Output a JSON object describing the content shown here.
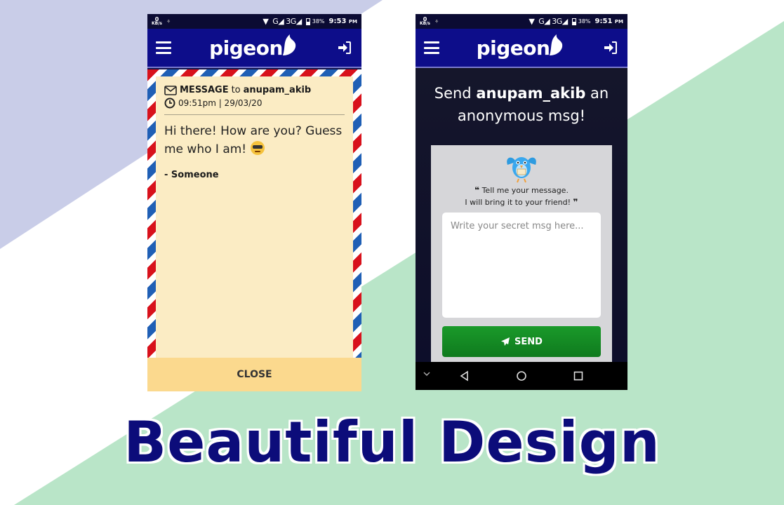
{
  "colors": {
    "bg_purple": "#c9cde8",
    "bg_green": "#b9e5c8",
    "appbar": "#0d0d8a",
    "headline": "#0c0c7a",
    "send_button": "#138a24",
    "letter_paper": "#fbecc4"
  },
  "left_phone": {
    "status": {
      "speed_value": "0",
      "speed_unit": "KB/s",
      "network": "G◢ 3G◢",
      "battery": "38%",
      "time": "9:53",
      "ampm": "PM"
    },
    "appbar": {
      "logo": "pigeon",
      "menu_icon": "menu-icon",
      "login_icon": "sign-in-icon"
    },
    "letter": {
      "header_prefix": "MESSAGE",
      "header_to": "to",
      "recipient": "anupam_akib",
      "datetime": "09:51pm | 29/03/20",
      "body": "Hi there! How are you? Guess me who I am!",
      "signature": "- Someone"
    },
    "close_label": "CLOSE"
  },
  "right_phone": {
    "status": {
      "speed_value": "0",
      "speed_unit": "KB/s",
      "network": "G◢ 3G◢",
      "battery": "38%",
      "time": "9:51",
      "ampm": "PM"
    },
    "appbar": {
      "logo": "pigeon",
      "menu_icon": "menu-icon",
      "login_icon": "sign-in-icon"
    },
    "title_prefix": "Send",
    "title_user": "anupam_akib",
    "title_suffix_1": "an",
    "title_line2": "anonymous msg!",
    "tagline_1": "Tell me your message.",
    "tagline_2": "I will bring it to your friend!",
    "message_placeholder": "Write your secret msg here...",
    "send_label": "SEND"
  },
  "headline": "Beautiful Design"
}
